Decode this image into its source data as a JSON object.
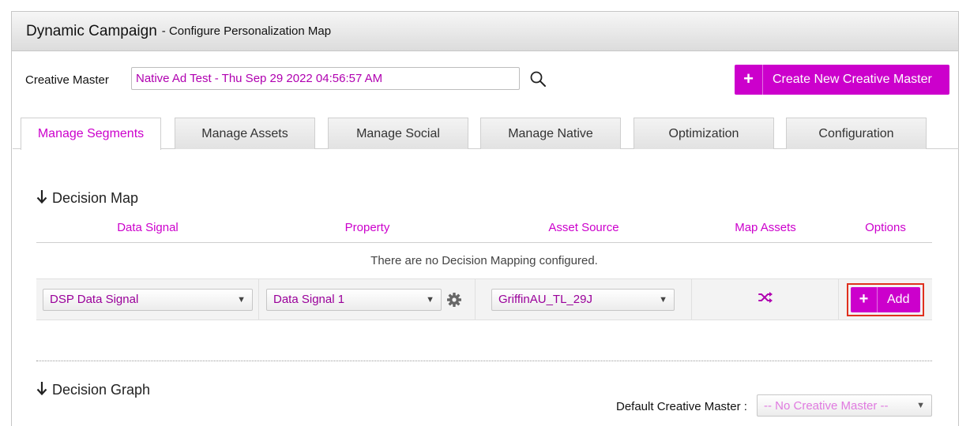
{
  "header": {
    "title": "Dynamic Campaign",
    "subtitle": "- Configure Personalization Map"
  },
  "creative_master": {
    "label": "Creative Master",
    "value": "Native Ad Test - Thu Sep 29 2022 04:56:57 AM",
    "create_button_label": "Create New Creative Master"
  },
  "tabs": [
    {
      "label": "Manage Segments",
      "active": true
    },
    {
      "label": "Manage Assets",
      "active": false
    },
    {
      "label": "Manage Social",
      "active": false
    },
    {
      "label": "Manage Native",
      "active": false
    },
    {
      "label": "Optimization",
      "active": false
    },
    {
      "label": "Configuration",
      "active": false
    }
  ],
  "decision_map": {
    "title": "Decision Map",
    "columns": [
      "Data Signal",
      "Property",
      "Asset Source",
      "Map Assets",
      "Options"
    ],
    "empty_message": "There are no Decision Mapping configured.",
    "row": {
      "data_signal": "DSP Data Signal",
      "property": "Data Signal 1",
      "asset_source": "GriffinAU_TL_29J",
      "add_label": "Add"
    }
  },
  "decision_graph": {
    "title": "Decision Graph",
    "default_label": "Default Creative Master :",
    "default_value": "-- No Creative Master --"
  },
  "colors": {
    "accent": "#cc00cc",
    "highlight_border": "#e0301e"
  }
}
